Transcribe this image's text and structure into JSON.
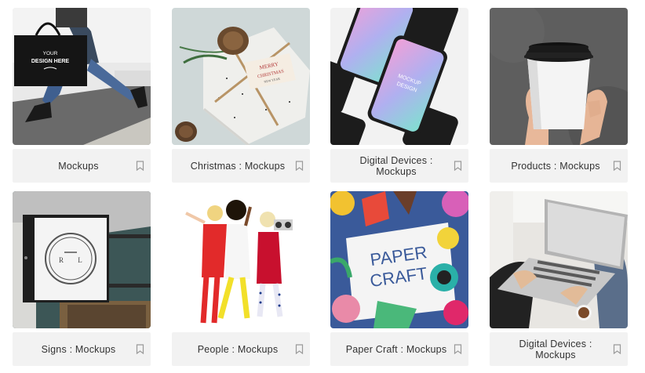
{
  "cards": [
    {
      "label": "Mockups",
      "image": "shopping-bag-mockup-photo",
      "bag_text": [
        "YOUR",
        "DESIGN HERE"
      ]
    },
    {
      "label": "Christmas : Mockups",
      "image": "christmas-gift-box-photo",
      "tag_text": [
        "MERRY",
        "CHRISTMAS",
        "NEW YEAR"
      ]
    },
    {
      "label": "Digital Devices : Mockups",
      "image": "phone-mockups-photo",
      "screen_text": [
        "MOCKUP",
        "DESIGN"
      ]
    },
    {
      "label": "Products : Mockups",
      "image": "coffee-cup-mockup-photo"
    },
    {
      "label": "Signs : Mockups",
      "image": "hanging-sign-mockup-photo",
      "sign_text": [
        "R",
        "L"
      ]
    },
    {
      "label": "People : Mockups",
      "image": "dancing-people-photo"
    },
    {
      "label": "Paper Craft : Mockups",
      "image": "paper-craft-illustration",
      "craft_text": [
        "PAPER",
        "CRAFT"
      ]
    },
    {
      "label": "Digital Devices : Mockups",
      "image": "laptop-mockup-photo"
    }
  ],
  "colors": {
    "caption_bg": "#f2f2f2",
    "text": "#333333",
    "icon": "#9a9a9a"
  }
}
